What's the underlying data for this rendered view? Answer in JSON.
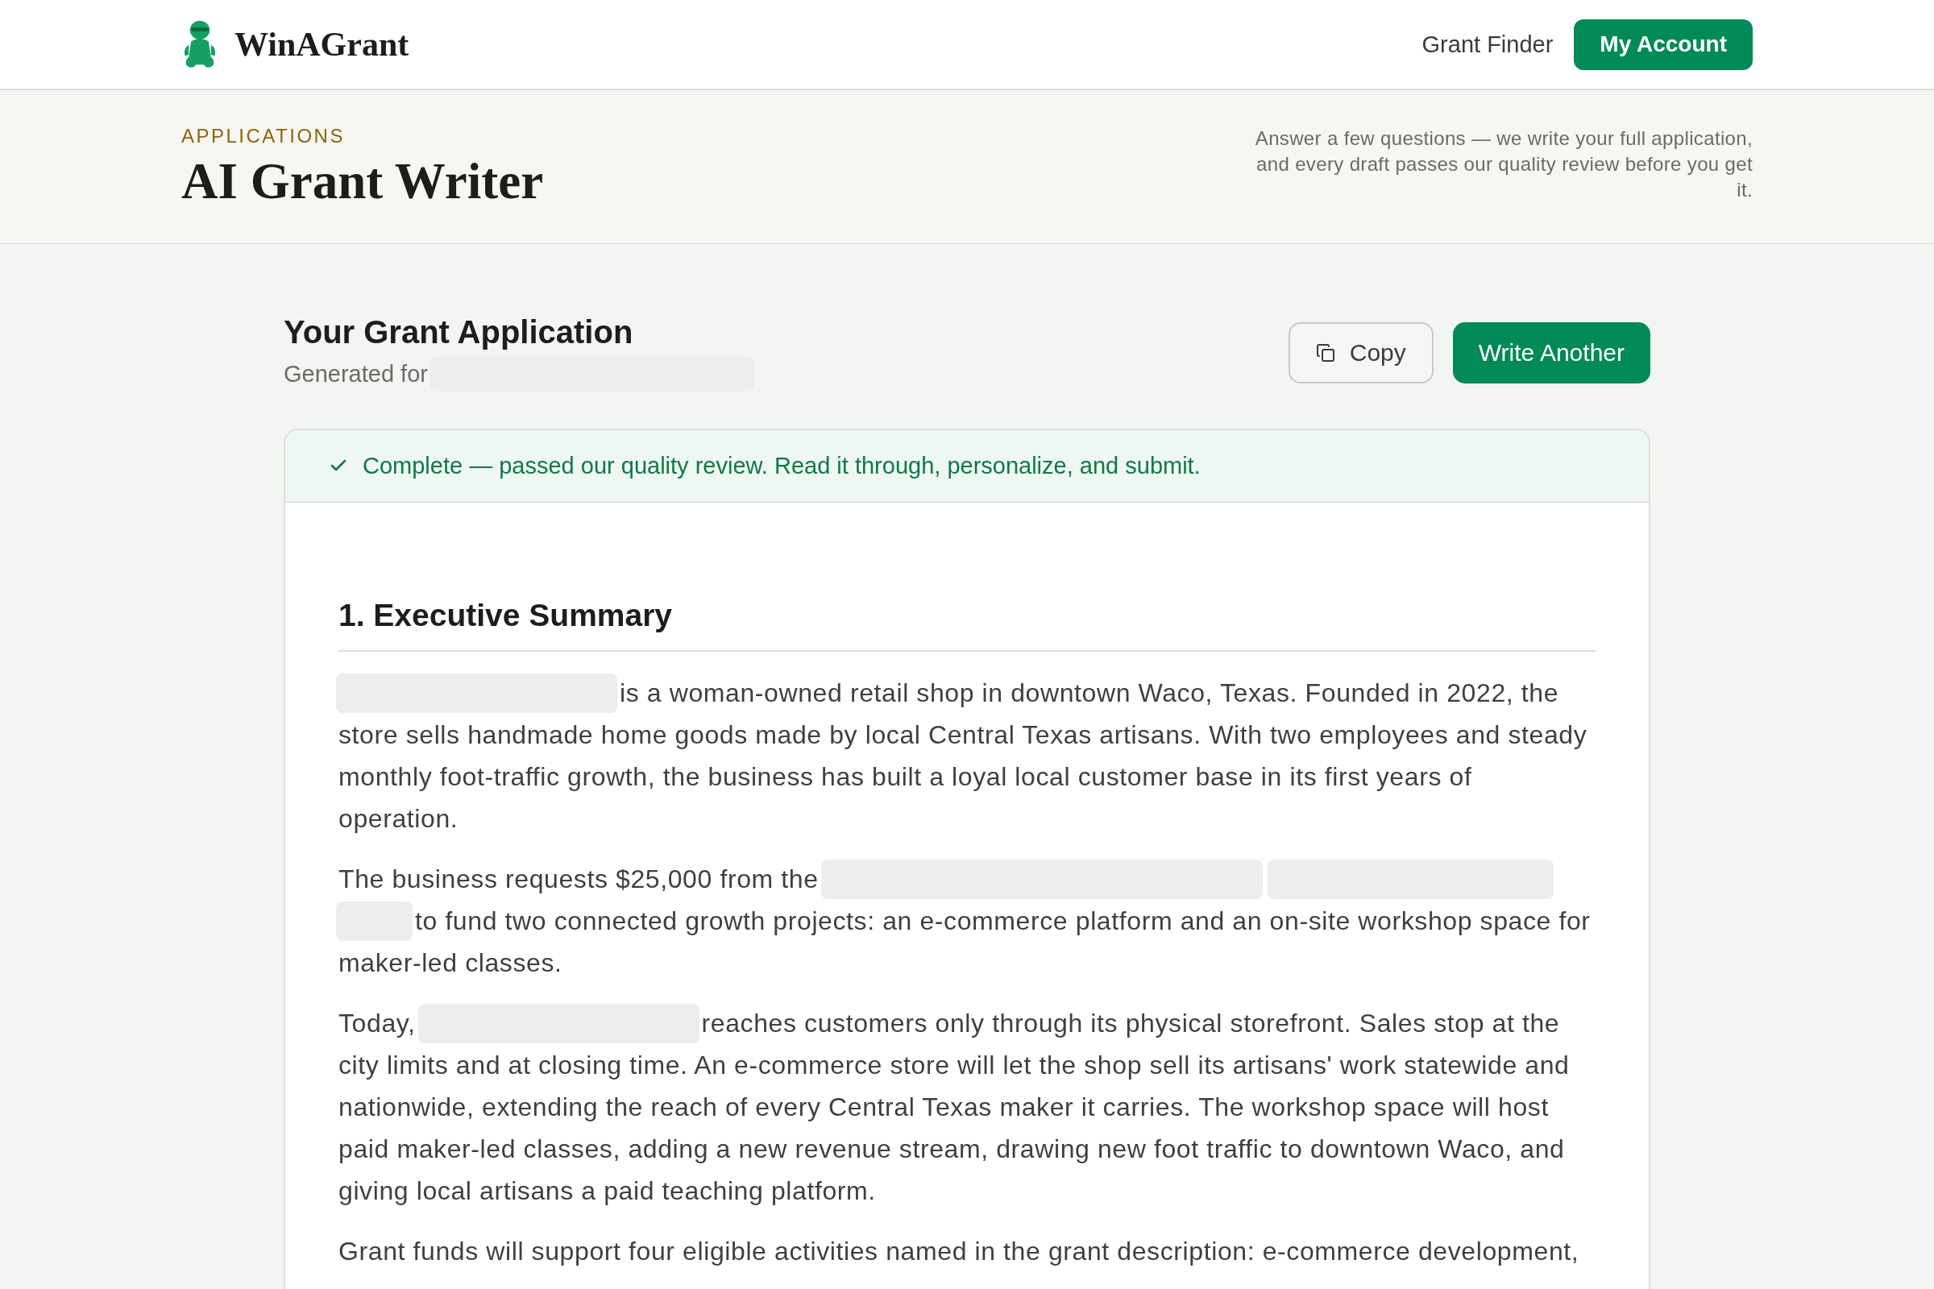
{
  "nav": {
    "logo_text": "WinAGrant",
    "items": [
      {
        "kind": "link",
        "label": "Grant Finder"
      },
      {
        "kind": "button",
        "label": "My Account"
      }
    ]
  },
  "page_header": {
    "eyebrow": "APPLICATIONS",
    "title": "AI Grant Writer",
    "description": "Answer a few questions — we write your full application, and every draft passes our quality review before you get it."
  },
  "application": {
    "title": "Your Grant Application",
    "subtitle": [
      {
        "kind": "text",
        "text": "Generated for"
      },
      {
        "kind": "redacted"
      }
    ],
    "actions": [
      {
        "kind": "copy",
        "label": "Copy"
      },
      {
        "kind": "primary",
        "label": "Write Another"
      }
    ]
  },
  "status": {
    "kind": "success",
    "text": "Complete — passed our quality review. Read it through, personalize, and submit."
  },
  "sections": [
    {
      "heading": "1. Executive Summary",
      "paragraphs": [
        {
          "opening_lines": [
            [
              {
                "kind": "redacted"
              },
              {
                "kind": "text",
                "text": "is a woman-owned retail shop in downtown Waco, Texas. Founded in 2022, the"
              }
            ]
          ],
          "text": "store sells handmade home goods made by local Central Texas artisans. With two employees and steady monthly foot-traffic growth, the business has built a loyal local customer base in its first years of operation."
        },
        {
          "opening_lines": [
            [
              {
                "kind": "text",
                "text": "The business requests $25,000 from the"
              },
              {
                "kind": "redacted"
              },
              {
                "kind": "redacted"
              }
            ],
            [
              {
                "kind": "redacted"
              },
              {
                "kind": "text",
                "text": "to fund two connected growth projects: an e-commerce platform and an on-site workshop space for"
              }
            ]
          ],
          "text": "maker-led classes."
        },
        {
          "opening_lines": [
            [
              {
                "kind": "text",
                "text": "Today,"
              },
              {
                "kind": "redacted"
              },
              {
                "kind": "text",
                "text": "reaches customers only through its physical storefront. Sales stop at the"
              }
            ]
          ],
          "text": "city limits and at closing time. An e-commerce store will let the shop sell its artisans' work statewide and nationwide, extending the reach of every Central Texas maker it carries. The workshop space will host paid maker-led classes, adding a new revenue stream, drawing new foot traffic to downtown Waco, and giving local artisans a paid teaching platform."
        },
        {
          "text": "Grant funds will support four eligible activities named in the grant description: e-commerce development,"
        }
      ]
    }
  ]
}
